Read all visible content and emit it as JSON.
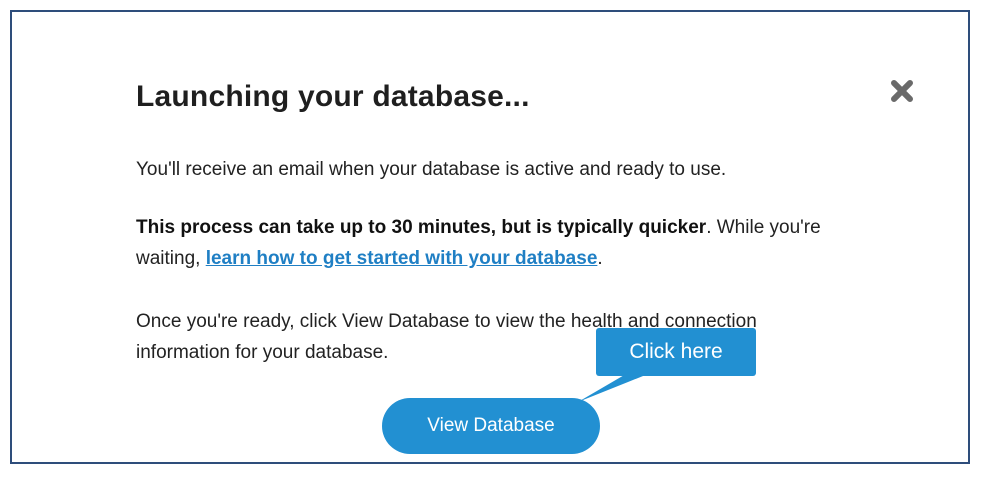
{
  "modal": {
    "title": "Launching your database...",
    "close_icon": "close-x-icon",
    "paragraph1": "You'll receive an email when your database is active and ready to use.",
    "paragraph2": {
      "bold": "This process can take up to 30 minutes, but is typically quicker",
      "after_bold": ". While you're waiting, ",
      "link": "learn how to get started with your database",
      "after_link": "."
    },
    "paragraph3": "Once you're ready, click View Database to view the health and connection information for your database.",
    "view_button_label": "View Database"
  },
  "callout": {
    "label": "Click here"
  },
  "colors": {
    "border": "#2e4d7b",
    "accent": "#2290d2",
    "link": "#1f7fc4"
  }
}
